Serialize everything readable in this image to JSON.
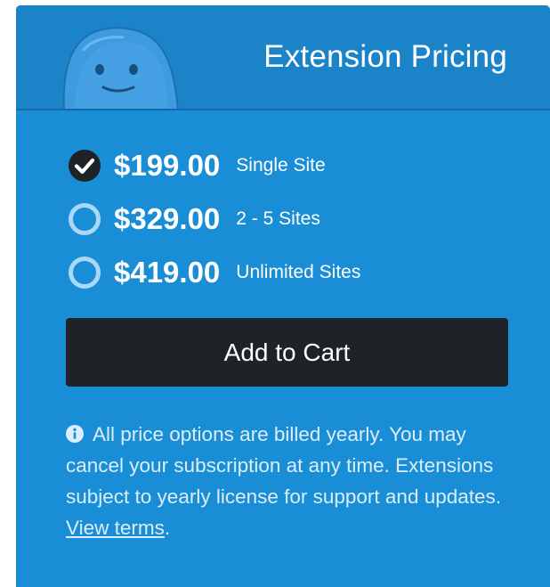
{
  "header": {
    "title": "Extension Pricing"
  },
  "pricing": {
    "options": [
      {
        "price": "$199.00",
        "label": "Single Site",
        "selected": true
      },
      {
        "price": "$329.00",
        "label": "2 - 5 Sites",
        "selected": false
      },
      {
        "price": "$419.00",
        "label": "Unlimited Sites",
        "selected": false
      }
    ]
  },
  "cart": {
    "button_label": "Add to Cart"
  },
  "notice": {
    "text": "All price options are billed yearly. You may cancel your subscription at any time. Extensions subject to yearly license for support and updates.",
    "link_text": "View terms",
    "suffix": "."
  },
  "icons": {
    "mascot": "blue-blob-mascot",
    "selected_radio": "check-circle-icon",
    "unselected_radio": "radio-circle-icon",
    "info": "info-icon"
  },
  "colors": {
    "card_background": "#198ed6",
    "header_background": "#1b84c8",
    "button_background": "#1f2328",
    "text_primary": "#ffffff",
    "text_secondary": "#dbeefa",
    "radio_ring": "#a9d8f6",
    "check_fill": "#1f2328"
  }
}
